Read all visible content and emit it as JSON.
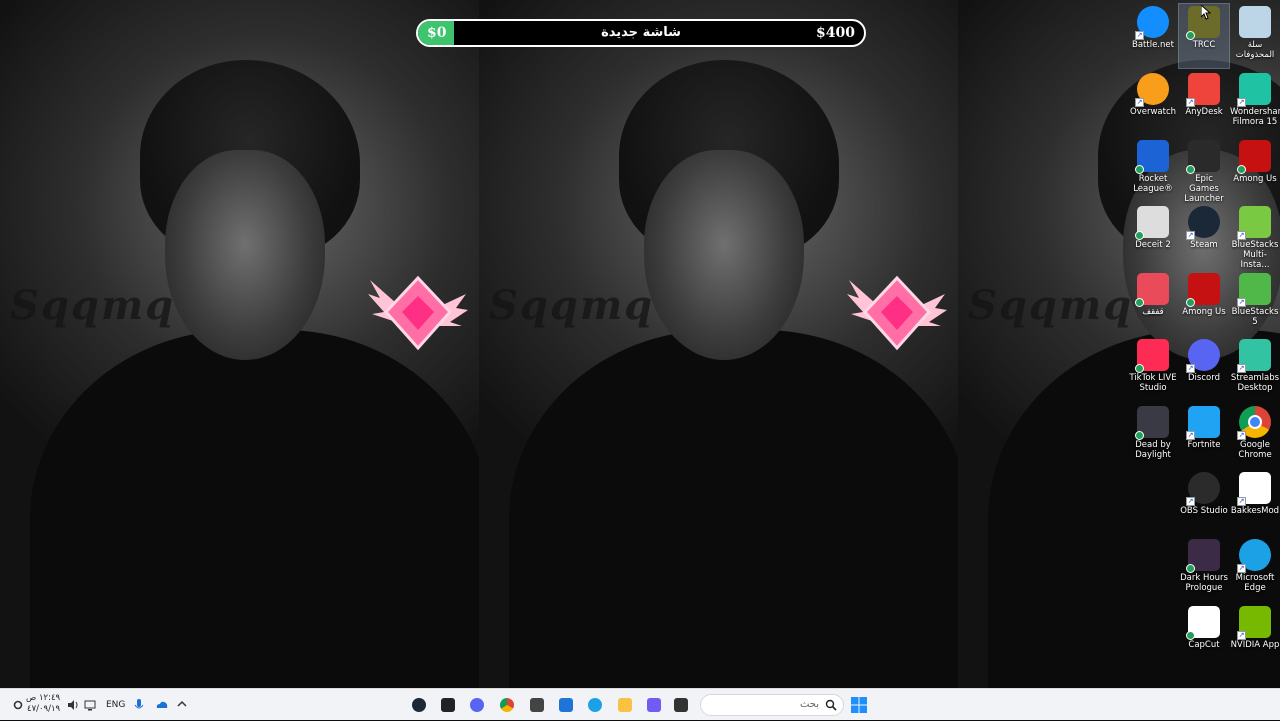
{
  "wallpaper": {
    "watermark": "Sqqmq"
  },
  "topbar": {
    "min_label": "$0",
    "max_label": "$400",
    "title": "شاشة جديدة",
    "progress": 0.08
  },
  "desktop_icons": [
    {
      "id": "battlenet",
      "label": "Battle.net",
      "icon": "battlenet-icon",
      "color": "#148eff"
    },
    {
      "id": "trcc",
      "label": "TRCC",
      "icon": "trcc-icon",
      "color": "#6b6b2a"
    },
    {
      "id": "recycle",
      "label": "سلة\nالمحذوفات",
      "icon": "recycle-bin-icon",
      "color": "#bcd6e8"
    },
    {
      "id": "overwatch",
      "label": "Overwatch",
      "icon": "overwatch-icon",
      "color": "#f99e1a"
    },
    {
      "id": "anydesk",
      "label": "AnyDesk",
      "icon": "anydesk-icon",
      "color": "#ef443b"
    },
    {
      "id": "filmora",
      "label": "Wondershare\nFilmora 15",
      "icon": "filmora-icon",
      "color": "#1fc3a3"
    },
    {
      "id": "rocket",
      "label": "Rocket\nLeague®",
      "icon": "rocket-league-icon",
      "color": "#1c63d6"
    },
    {
      "id": "epic",
      "label": "Epic Games\nLauncher",
      "icon": "epic-games-icon",
      "color": "#2a2a2a"
    },
    {
      "id": "amongus1",
      "label": "Among Us",
      "icon": "among-us-icon",
      "color": "#c51111"
    },
    {
      "id": "deceit",
      "label": "Deceit 2",
      "icon": "deceit-icon",
      "color": "#dddddd"
    },
    {
      "id": "steam",
      "label": "Steam",
      "icon": "steam-icon",
      "color": "#1b2838"
    },
    {
      "id": "bluestacks-multi",
      "label": "BlueStacks\nMulti-Insta...",
      "icon": "bluestacks-multi-icon",
      "color": "#7ac943"
    },
    {
      "id": "qafqaf",
      "label": "قفقف",
      "icon": "qafqaf-icon",
      "color": "#e94b5a"
    },
    {
      "id": "amongus2",
      "label": "Among Us",
      "icon": "among-us-icon",
      "color": "#c51111"
    },
    {
      "id": "bluestacks5",
      "label": "BlueStacks 5",
      "icon": "bluestacks-icon",
      "color": "#4fb848"
    },
    {
      "id": "tiktok",
      "label": "TikTok LIVE\nStudio",
      "icon": "tiktok-live-icon",
      "color": "#fe2c55"
    },
    {
      "id": "discord",
      "label": "Discord",
      "icon": "discord-icon",
      "color": "#5865f2"
    },
    {
      "id": "streamlabs",
      "label": "Streamlabs\nDesktop",
      "icon": "streamlabs-icon",
      "color": "#31c3a2"
    },
    {
      "id": "dbd",
      "label": "Dead by\nDaylight",
      "icon": "dead-by-daylight-icon",
      "color": "#3a3a44"
    },
    {
      "id": "fortnite",
      "label": "Fortnite",
      "icon": "fortnite-icon",
      "color": "#1fa3f2"
    },
    {
      "id": "chrome",
      "label": "Google\nChrome",
      "icon": "chrome-icon",
      "color": "#ffffff"
    },
    {
      "id": "obs",
      "label": "OBS Studio",
      "icon": "obs-icon",
      "color": "#2b2b2b"
    },
    {
      "id": "bakkesmod",
      "label": "BakkesMod",
      "icon": "bakkesmod-icon",
      "color": "#ffffff"
    },
    {
      "id": "darkhours",
      "label": "Dark Hours\nPrologue",
      "icon": "dark-hours-icon",
      "color": "#3b2b47"
    },
    {
      "id": "edge",
      "label": "Microsoft\nEdge",
      "icon": "edge-icon",
      "color": "#1da1e6"
    },
    {
      "id": "capcut",
      "label": "CapCut",
      "icon": "capcut-icon",
      "color": "#ffffff"
    },
    {
      "id": "nvidia",
      "label": "NVIDIA App",
      "icon": "nvidia-icon",
      "color": "#76b900"
    }
  ],
  "taskbar": {
    "search_placeholder": "بحث",
    "apps": [
      {
        "name": "windows-start-icon",
        "color": "#1e8fff"
      },
      {
        "name": "blank-window-icon",
        "color": "#333333"
      },
      {
        "name": "copilot-icon",
        "color": "#6f5cf5"
      },
      {
        "name": "microsoft-store-icon",
        "color": "#1f74d8"
      },
      {
        "name": "file-explorer-icon",
        "color": "#f7c340"
      },
      {
        "name": "edge-icon",
        "color": "#1da1e6"
      },
      {
        "name": "calculator-icon",
        "color": "#1c63b7"
      },
      {
        "name": "package-icon",
        "color": "#444444"
      },
      {
        "name": "chrome-icon",
        "color": "#4285f4"
      },
      {
        "name": "discord-icon",
        "color": "#5865f2"
      },
      {
        "name": "app-icon",
        "color": "#222222"
      },
      {
        "name": "steam-icon",
        "color": "#1b2838"
      }
    ],
    "tray": {
      "language": "ENG",
      "time": "١٢:٤٩ ص",
      "date": "٤٧/٠٩/١٩"
    }
  }
}
